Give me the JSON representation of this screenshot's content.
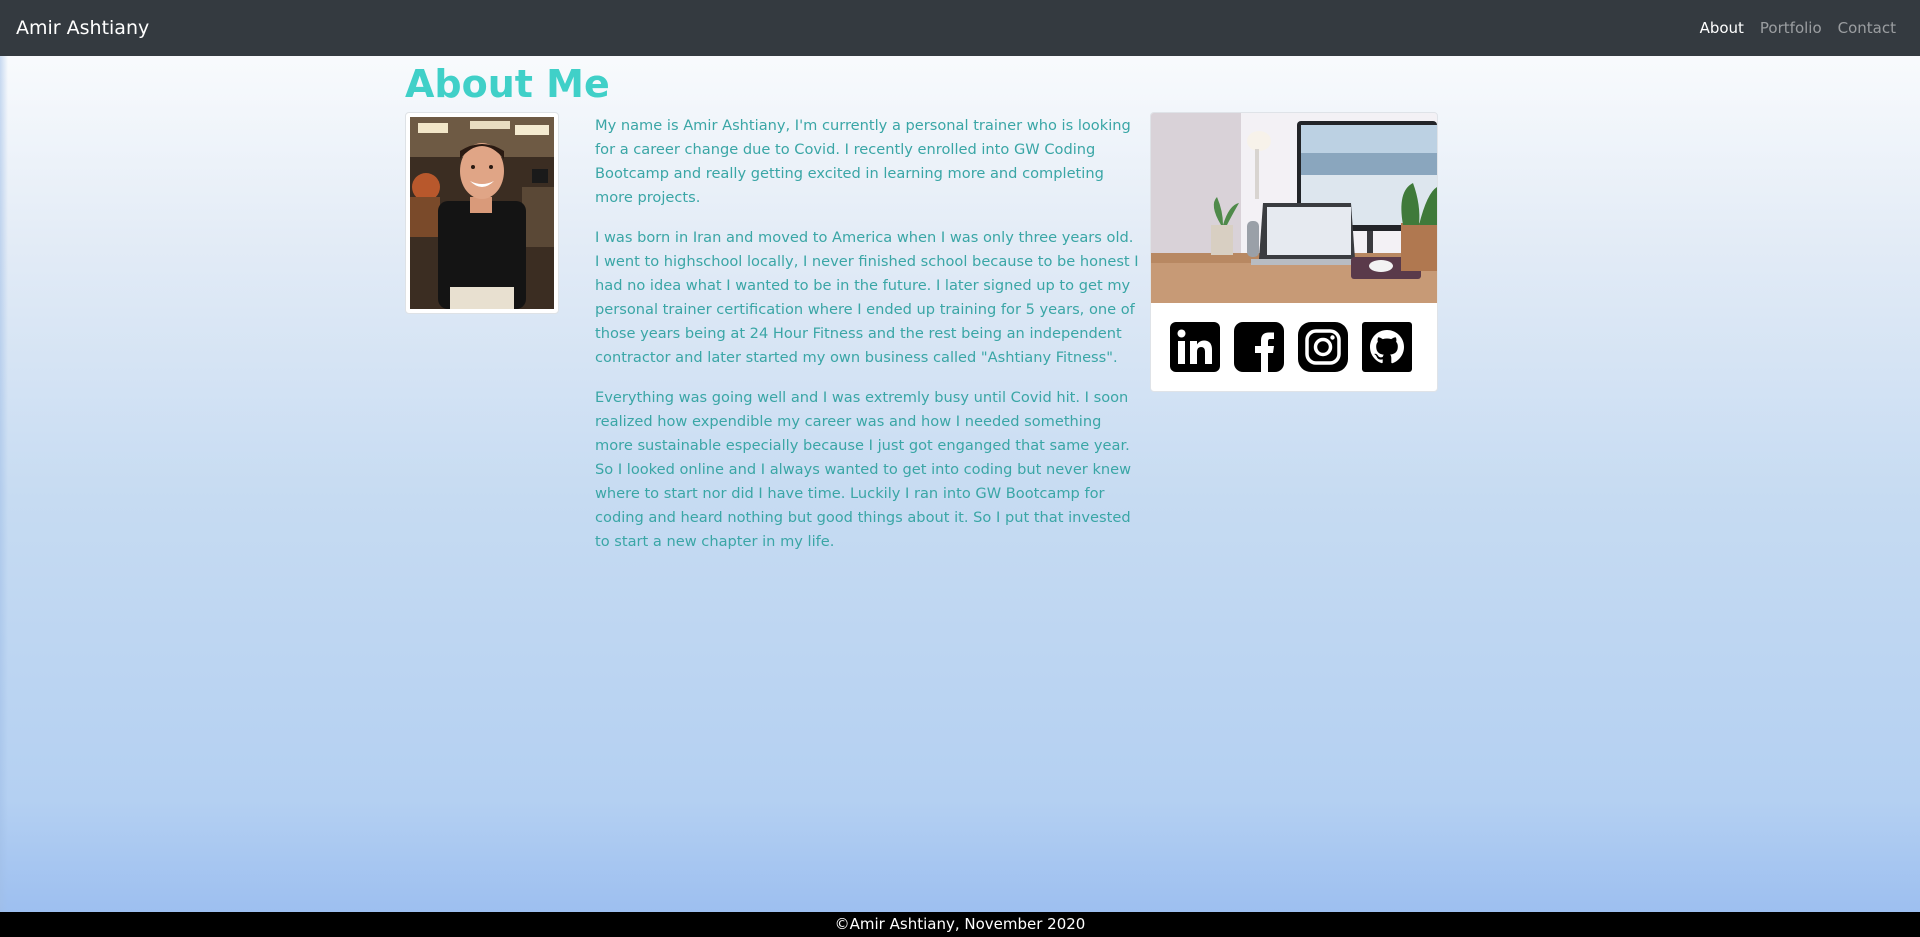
{
  "nav": {
    "brand": "Amir Ashtiany",
    "links": [
      {
        "label": "About",
        "active": true
      },
      {
        "label": "Portfolio",
        "active": false
      },
      {
        "label": "Contact",
        "active": false
      }
    ]
  },
  "main": {
    "title": "About Me",
    "paragraphs": [
      "My name is Amir Ashtiany, I'm currently a personal trainer who is looking for a career change due to Covid. I recently enrolled into GW Coding Bootcamp and really getting excited in learning more and completing more projects.",
      "I was born in Iran and moved to America when I was only three years old. I went to highschool locally, I never finished school because to be honest I had no idea what I wanted to be in the future. I later signed up to get my personal trainer certification where I ended up training for 5 years, one of those years being at 24 Hour Fitness and the rest being an independent contractor and later started my own business called \"Ashtiany Fitness\".",
      "Everything was going well and I was extremly busy until Covid hit. I soon realized how expendible my career was and how I needed something more sustainable especially because I just got enganged that same year. So I looked online and I always wanted to get into coding but never knew where to start nor did I have time. Luckily I ran into GW Bootcamp for coding and heard nothing but good things about it. So I put that invested to start a new chapter in my life."
    ]
  },
  "social": {
    "icons": [
      "linkedin-icon",
      "facebook-icon",
      "instagram-icon",
      "github-icon"
    ]
  },
  "footer": {
    "text": "©Amir Ashtiany, November 2020"
  },
  "colors": {
    "navbar": "#343a40",
    "accent": "#40d0c8",
    "body_text": "#3aa6a6",
    "footer": "#000000"
  }
}
